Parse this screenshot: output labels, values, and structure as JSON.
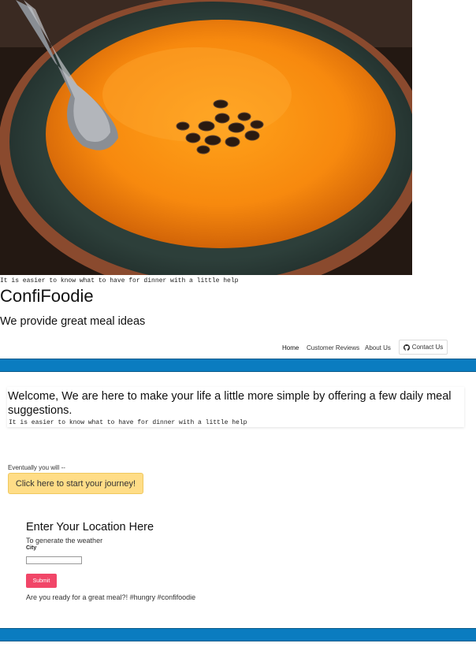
{
  "hero": {
    "image_alt": "bowl-of-soup-photo",
    "caption": "It is easier to know what to have for dinner with a little help"
  },
  "header": {
    "brand": "ConfiFoodie",
    "tagline": "We provide great meal ideas"
  },
  "nav": {
    "items": [
      "Home",
      "Customer Reviews",
      "About Us"
    ],
    "contact_label": "Contact Us",
    "contact_icon": "github-icon"
  },
  "welcome": {
    "title": "Welcome, We are here to make your life a little more simple by offering a few daily meal suggestions.",
    "subtitle": "It is easier to know what to have for dinner with a little help"
  },
  "journey": {
    "lead": "Eventually you will --",
    "button_label": "Click here to start your journey!"
  },
  "location": {
    "title": "Enter Your Location Here",
    "subtitle": "To generate the weather",
    "city_label": "City",
    "city_value": "",
    "submit_label": "Submit",
    "footer_text": "Are you ready for a great meal?! #hungry #confifoodie"
  },
  "colors": {
    "band": "#0a7cc0",
    "journey_button": "#ffdd87",
    "submit_button": "#f14668"
  }
}
